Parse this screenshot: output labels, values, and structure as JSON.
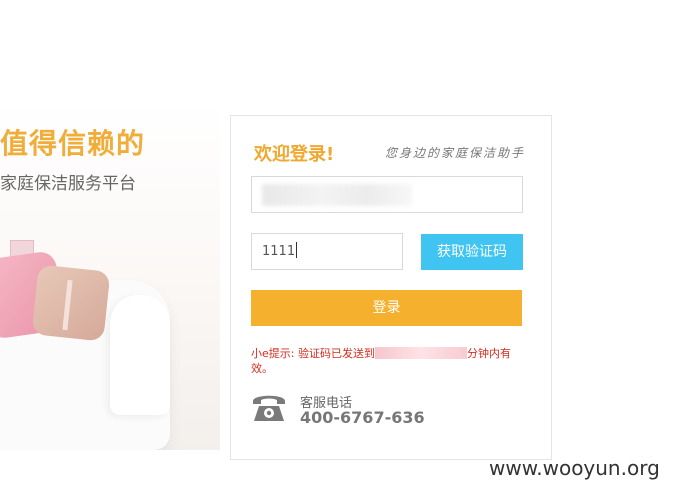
{
  "promo": {
    "slogan": "值得信赖的",
    "tagline": "家庭保洁服务平台"
  },
  "login": {
    "welcome": "欢迎登录!",
    "assistant_slogan": "您身边的家庭保洁助手",
    "phone_value": "",
    "code_value": "1111",
    "get_code_label": "获取验证码",
    "login_label": "登录",
    "hint_prefix": "小e提示: 验证码已发送到",
    "hint_suffix": "分钟内有效。"
  },
  "service": {
    "label": "客服电话",
    "number": "400-6767-636"
  },
  "watermark": "www.wooyun.org",
  "colors": {
    "accent_orange": "#f5b02e",
    "accent_blue": "#40c4f1",
    "hint_red": "#d52b1e"
  },
  "icons": {
    "phone": "telephone-icon"
  }
}
